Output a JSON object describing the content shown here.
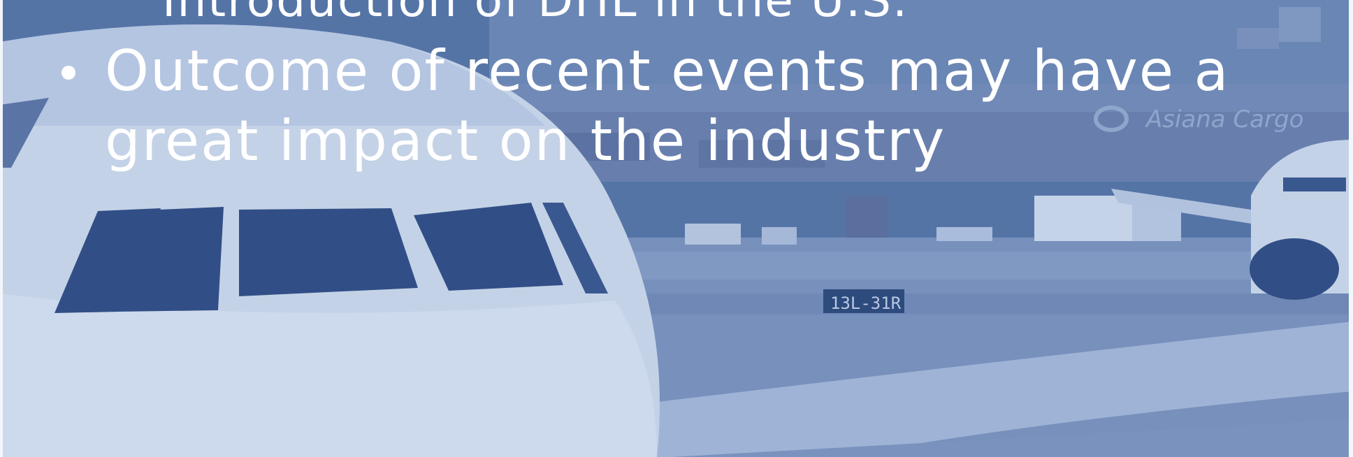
{
  "slide": {
    "sub_bullet": "Introduction of DHL in the U.S.",
    "bullet_line_1": "Outcome of recent events may have a",
    "bullet_line_2": "great impact on the industry",
    "background_photo": "airport-apron-aircraft-cargo-terminal",
    "terminal_sign": "Asiana Cargo",
    "runway_sign": "13L-31R"
  },
  "colors": {
    "overlay": "#5574a6",
    "text": "#ffffff",
    "aircraft_light": "#c4d2e7",
    "window_dark": "#314f86"
  }
}
